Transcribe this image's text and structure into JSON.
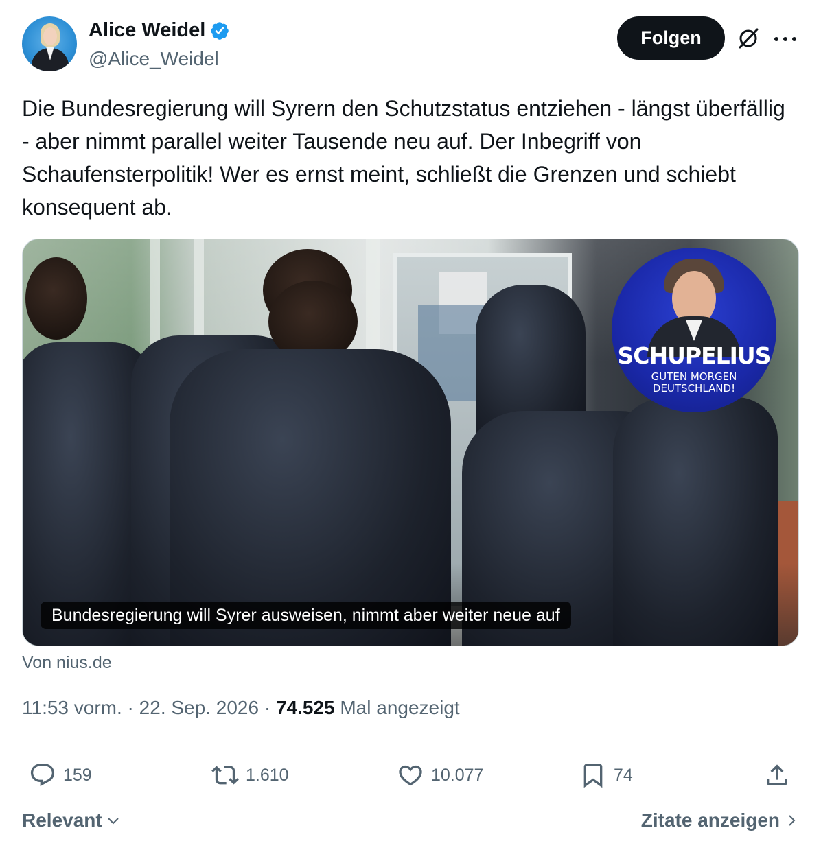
{
  "author": {
    "name": "Alice Weidel",
    "handle": "@Alice_Weidel",
    "verified": true
  },
  "header": {
    "follow_label": "Folgen"
  },
  "tweet": {
    "text": "Die Bundesregierung will Syrern den Schutzstatus entziehen - längst überfällig - aber nimmt parallel weiter Tausende neu auf. Der Inbegriff von Schaufensterpolitik! Wer es ernst meint, schließt die Grenzen und schiebt konsequent ab."
  },
  "media": {
    "caption": "Bundesregierung will Syrer ausweisen, nimmt aber weiter neue auf",
    "badge_title": "SCHUPELIUS",
    "badge_subtitle_line1": "GUTEN MORGEN",
    "badge_subtitle_line2": "DEUTSCHLAND!",
    "source": "Von nius.de"
  },
  "meta": {
    "time": "11:53 vorm.",
    "separator": " · ",
    "date": "22. Sep. 2026",
    "views_count": "74.525",
    "views_label": "Mal angezeigt"
  },
  "actions": {
    "replies": "159",
    "reposts": "1.610",
    "likes": "10.077",
    "bookmarks": "74"
  },
  "footer": {
    "sort_label": "Relevant",
    "quotes_label": "Zitate anzeigen"
  },
  "colors": {
    "verified_blue": "#1d9bf0",
    "text_primary": "#0f1419",
    "text_secondary": "#536471"
  }
}
